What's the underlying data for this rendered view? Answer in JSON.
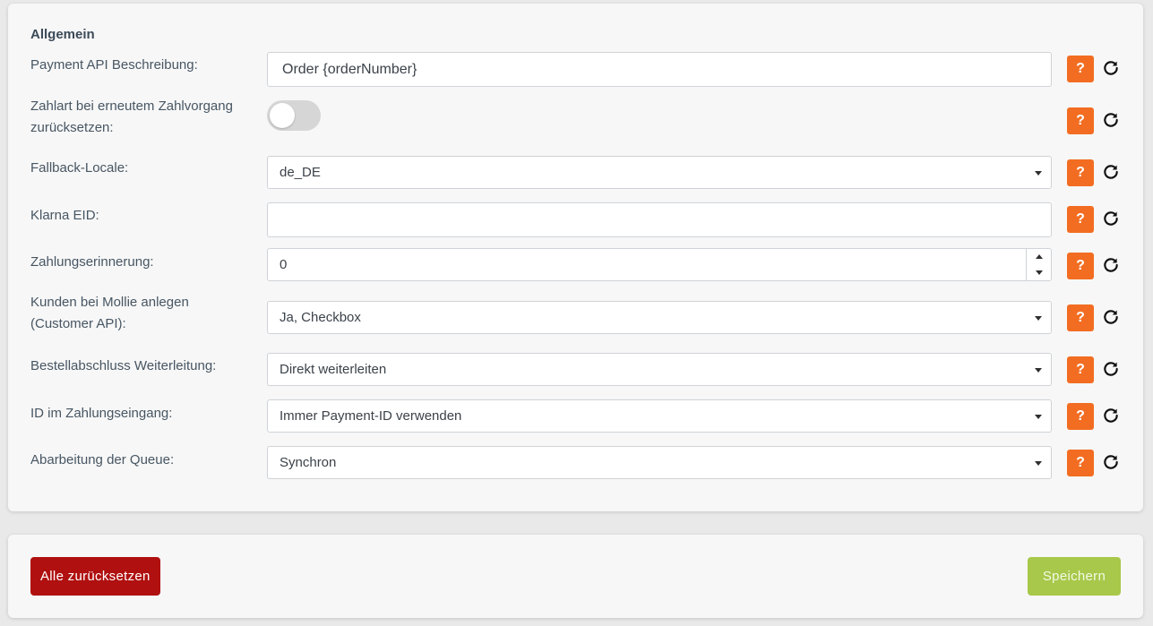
{
  "section": {
    "title": "Allgemein"
  },
  "rows": {
    "payment_description": {
      "label": "Payment API Beschreibung:",
      "value": "Order {orderNumber}"
    },
    "reset_payment": {
      "label": "Zahlart bei erneutem Zahlvorgang zurücksetzen:",
      "enabled": false
    },
    "fallback_locale": {
      "label": "Fallback-Locale:",
      "value": "de_DE"
    },
    "klarna_eid": {
      "label": "Klarna EID:",
      "value": ""
    },
    "payment_reminder": {
      "label": "Zahlungserinnerung:",
      "value": "0"
    },
    "create_customers": {
      "label": "Kunden bei Mollie anlegen (Customer API):",
      "value": "Ja, Checkbox"
    },
    "order_redirect": {
      "label": "Bestellabschluss Weiterleitung:",
      "value": "Direkt weiterleiten"
    },
    "payment_id": {
      "label": "ID im Zahlungseingang:",
      "value": "Immer Payment-ID verwenden"
    },
    "queue": {
      "label": "Abarbeitung der Queue:",
      "value": "Synchron"
    }
  },
  "help_label": "?",
  "icons": {
    "help": "question-icon",
    "reset": "reset-icon"
  },
  "actions": {
    "reset_all_label": "Alle zurücksetzen",
    "save_label": "Speichern"
  },
  "colors": {
    "help_button": "#f26d21",
    "reset_all_button": "#b01010",
    "save_button": "#a7c84a"
  }
}
